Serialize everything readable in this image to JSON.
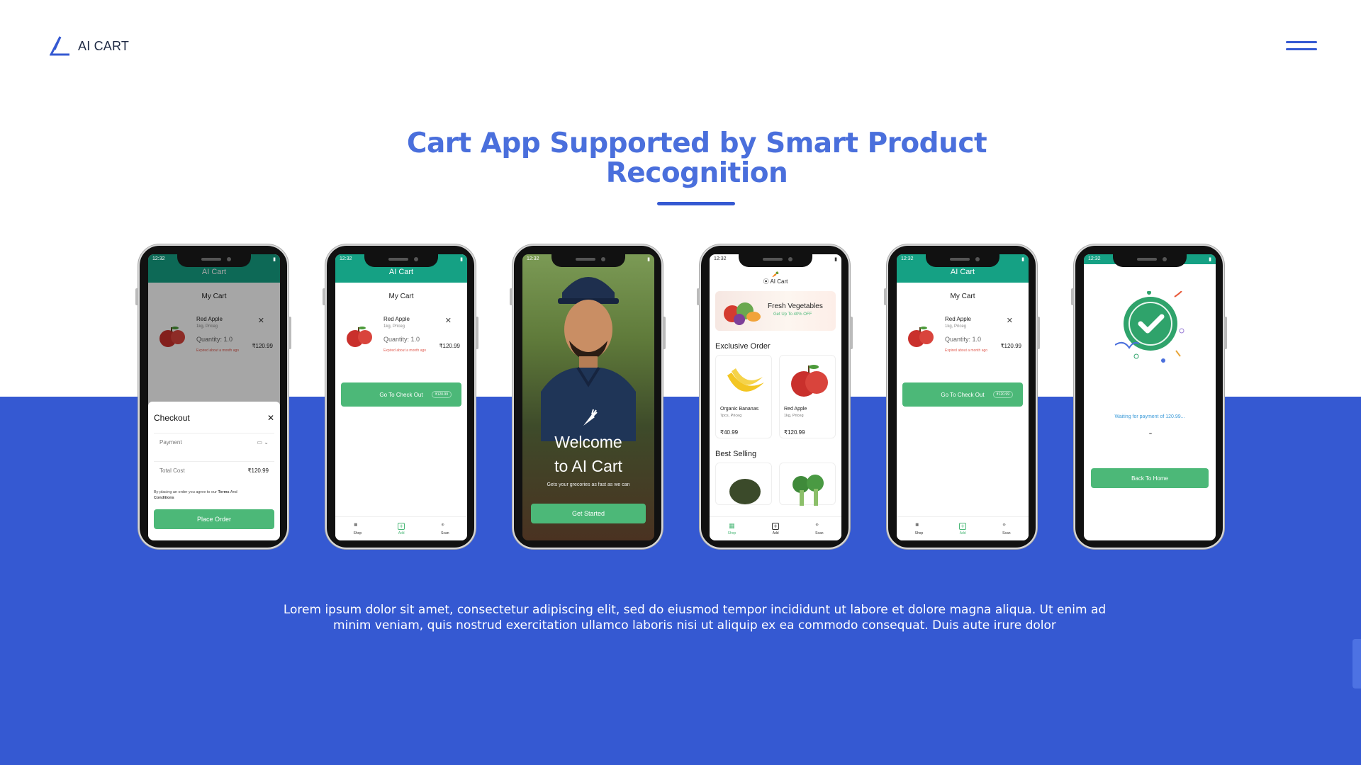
{
  "brand": {
    "name": "AI CART"
  },
  "hero": {
    "title": "Cart App Supported by Smart Product Recognition"
  },
  "description": "Lorem ipsum dolor sit amet, consectetur adipiscing elit, sed do eiusmod tempor incididunt ut labore et dolore magna aliqua. Ut enim ad minim veniam, quis nostrud exercitation ullamco laboris nisi ut aliquip ex ea commodo consequat. Duis aute irure dolor",
  "colors": {
    "accent": "#3559d2",
    "title": "#4a6fdc",
    "appbar": "#15a184",
    "button": "#4cb878"
  },
  "phones": {
    "status_time": "12:32",
    "app_title": "AI Cart",
    "cart": {
      "heading": "My Cart",
      "item_name": "Red Apple",
      "item_sub": "1kg, Priceg",
      "item_qty": "Quantity: 1.0",
      "item_exp": "Expired about a month ago",
      "item_price": "₹120.99",
      "checkout_label": "Go To Check Out",
      "checkout_pill": "₹120.99"
    },
    "checkout_sheet": {
      "title": "Checkout",
      "payment_label": "Payment",
      "total_label": "Total Cost",
      "total_value": "₹120.99",
      "note_prefix": "By placing an order you agree to our",
      "note_terms": "Terms",
      "note_and": "And",
      "note_conditions": "Conditions",
      "place_label": "Place Order"
    },
    "nav": {
      "shop": "Shop",
      "add": "Add",
      "scan": "Scan"
    },
    "welcome": {
      "title_line1": "Welcome",
      "title_line2": "to AI Cart",
      "subtitle": "Gets your grecories as fast as we can",
      "button": "Get Started"
    },
    "shop": {
      "app_name": "AI Cart",
      "banner_title": "Fresh Vegetables",
      "banner_sub": "Get Up To 40% OFF",
      "exclusive_title": "Exclusive Order",
      "best_title": "Best Selling",
      "products": [
        {
          "name": "Organic Bananas",
          "sub": "7pcs, Priceg",
          "price": "₹40.99"
        },
        {
          "name": "Red Apple",
          "sub": "1kg, Priceg",
          "price": "₹120.99"
        }
      ]
    },
    "success": {
      "waiting": "Waiting for payment of 120.99...",
      "button": "Back To Home"
    }
  }
}
